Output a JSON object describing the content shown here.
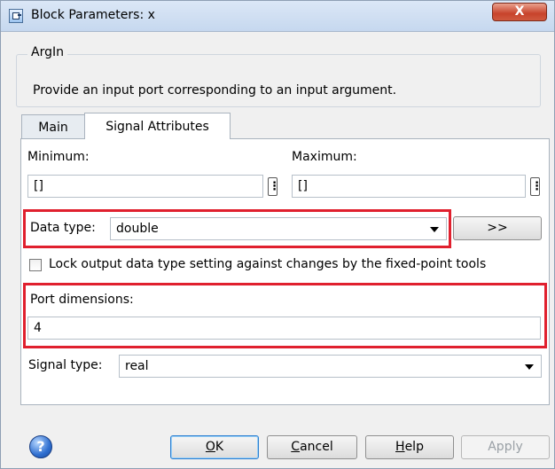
{
  "window": {
    "title": "Block Parameters: x",
    "close_glyph": "X"
  },
  "group": {
    "title": "ArgIn",
    "description": "Provide an input port corresponding to an input argument."
  },
  "tabs": [
    {
      "label": "Main",
      "selected": false
    },
    {
      "label": "Signal Attributes",
      "selected": true
    }
  ],
  "signal_attributes": {
    "minimum_label": "Minimum:",
    "minimum_value": "[]",
    "maximum_label": "Maximum:",
    "maximum_value": "[]",
    "more_glyph": "⋮",
    "data_type_label": "Data type:",
    "data_type_value": "double",
    "assistant_button_label": ">>",
    "lock_checkbox_label": "Lock output data type setting against changes by the fixed-point tools",
    "lock_checked": false,
    "port_dimensions_label": "Port dimensions:",
    "port_dimensions_value": "4",
    "signal_type_label": "Signal type:",
    "signal_type_value": "real"
  },
  "footer": {
    "help_icon_glyph": "?",
    "ok_prefix": "",
    "ok_mnemonic": "O",
    "ok_suffix": "K",
    "cancel_mnemonic": "C",
    "cancel_suffix": "ancel",
    "help_mnemonic": "H",
    "help_suffix": "elp",
    "apply_label": "Apply"
  },
  "colors": {
    "highlight_box": "#e0202e",
    "default_button_border": "#2c7fd1"
  }
}
